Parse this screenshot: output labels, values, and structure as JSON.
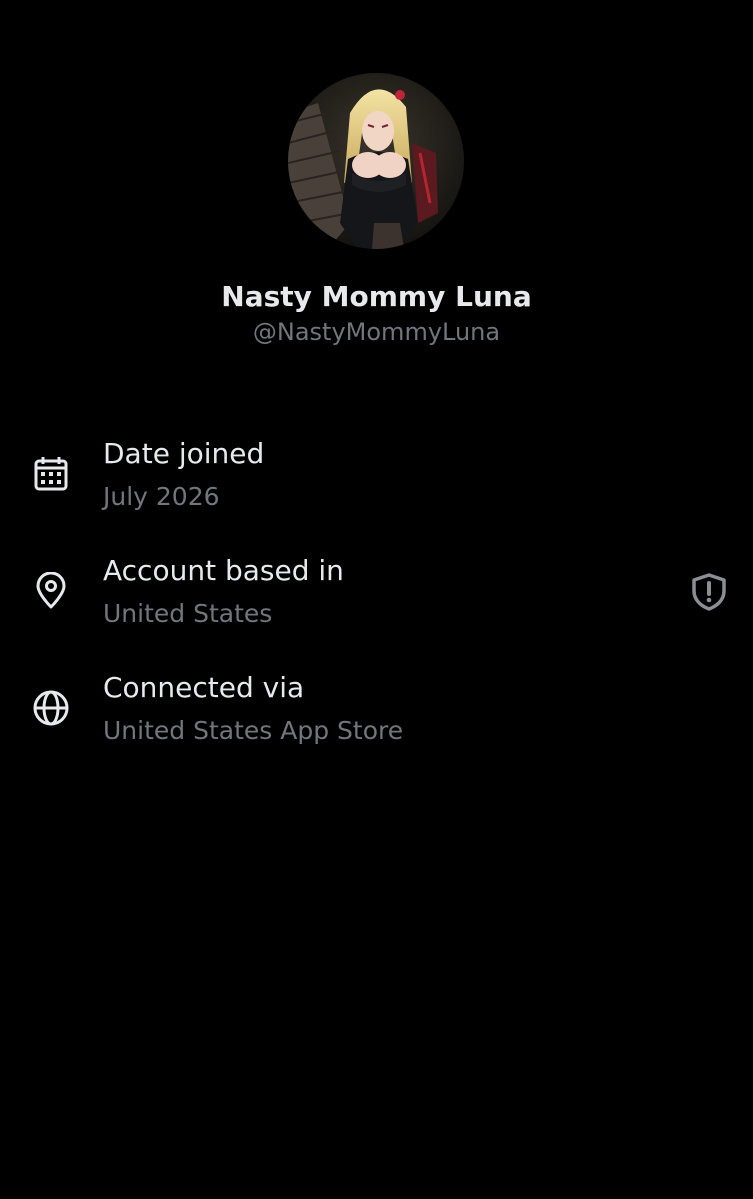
{
  "profile": {
    "display_name": "Nasty Mommy Luna",
    "handle": "@NastyMommyLuna"
  },
  "rows": [
    {
      "icon": "calendar-icon",
      "title": "Date joined",
      "value": "July 2026"
    },
    {
      "icon": "location-pin-icon",
      "title": "Account based in",
      "value": "United States",
      "badge": "shield-alert-icon"
    },
    {
      "icon": "globe-icon",
      "title": "Connected via",
      "value": "United States App Store"
    }
  ],
  "colors": {
    "background": "#000000",
    "primary_text": "#e7e9ea",
    "secondary_text": "#71767b",
    "shield": "#8b8f94"
  }
}
